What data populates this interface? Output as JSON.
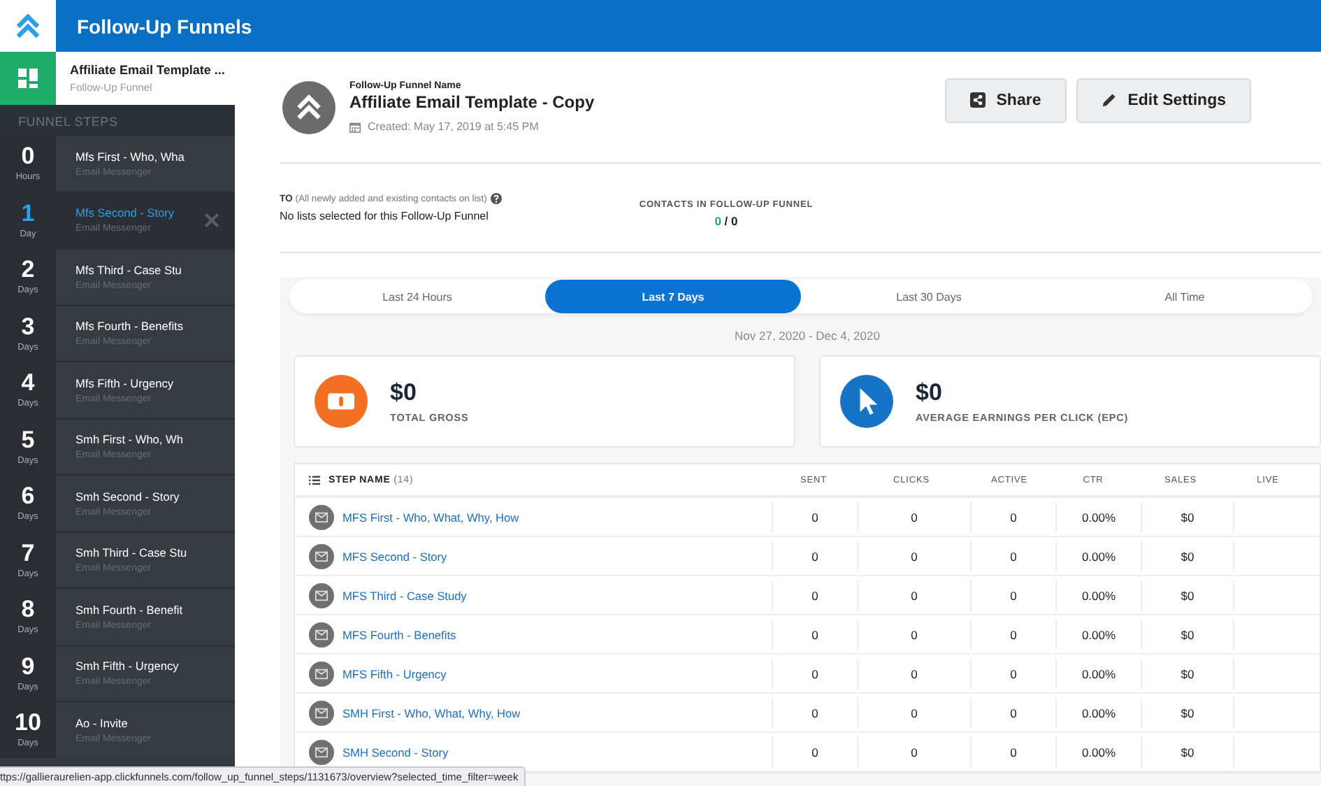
{
  "app": {
    "title": "Follow-Up Funnels"
  },
  "funnel": {
    "name": "Affiliate Email Template ...",
    "type": "Follow-Up Funnel"
  },
  "sidebar": {
    "heading": "FUNNEL STEPS",
    "steps": [
      {
        "number": "0",
        "unit": "Hours",
        "title": "Mfs First - Who, Wha",
        "subtitle": "Email Messenger",
        "selected": false
      },
      {
        "number": "1",
        "unit": "Day",
        "title": "Mfs Second - Story",
        "subtitle": "Email Messenger",
        "selected": true
      },
      {
        "number": "2",
        "unit": "Days",
        "title": "Mfs Third - Case Stu",
        "subtitle": "Email Messenger",
        "selected": false
      },
      {
        "number": "3",
        "unit": "Days",
        "title": "Mfs Fourth - Benefits",
        "subtitle": "Email Messenger",
        "selected": false
      },
      {
        "number": "4",
        "unit": "Days",
        "title": "Mfs Fifth - Urgency",
        "subtitle": "Email Messenger",
        "selected": false
      },
      {
        "number": "5",
        "unit": "Days",
        "title": "Smh First - Who, Wh",
        "subtitle": "Email Messenger",
        "selected": false
      },
      {
        "number": "6",
        "unit": "Days",
        "title": "Smh Second - Story",
        "subtitle": "Email Messenger",
        "selected": false
      },
      {
        "number": "7",
        "unit": "Days",
        "title": "Smh Third - Case Stu",
        "subtitle": "Email Messenger",
        "selected": false
      },
      {
        "number": "8",
        "unit": "Days",
        "title": "Smh Fourth - Benefit",
        "subtitle": "Email Messenger",
        "selected": false
      },
      {
        "number": "9",
        "unit": "Days",
        "title": "Smh Fifth - Urgency",
        "subtitle": "Email Messenger",
        "selected": false
      },
      {
        "number": "10",
        "unit": "Days",
        "title": "Ao - Invite",
        "subtitle": "Email Messenger",
        "selected": false
      }
    ]
  },
  "header": {
    "label": "Follow-Up Funnel Name",
    "title": "Affiliate Email Template - Copy",
    "created": "Created: May 17, 2019 at 5:45 PM",
    "buttons": [
      {
        "kind": "share",
        "label": "Share"
      },
      {
        "kind": "edit",
        "label": "Edit Settings"
      }
    ]
  },
  "recipients": {
    "label": "**TO** (All newly added and existing contacts on list)",
    "value": "No lists selected for this Follow-Up Funnel"
  },
  "contacts": {
    "label": "CONTACTS IN FOLLOW-UP FUNNEL",
    "count": "0",
    "separator": "/",
    "total": "0"
  },
  "tabs": [
    {
      "label": "Last 24 Hours",
      "selected": false
    },
    {
      "label": "Last 7 Days",
      "selected": true
    },
    {
      "label": "Last 30 Days",
      "selected": false
    },
    {
      "label": "All Time",
      "selected": false
    }
  ],
  "date_range": "Nov 27, 2020 - Dec 4, 2020",
  "stats": [
    {
      "kind": "gross",
      "value": "$0",
      "label": "TOTAL GROSS"
    },
    {
      "kind": "epc",
      "value": "$0",
      "label": "AVERAGE EARNINGS PER CLICK (EPC)"
    }
  ],
  "table": {
    "columns": [
      "**STEP NAME** (14)",
      "SENT",
      "CLICKS",
      "ACTIVE",
      "CTR",
      "SALES",
      "LIVE"
    ],
    "rows": [
      {
        "cells": [
          "MFS First - Who, What, Why, How",
          "0",
          "0",
          "0",
          "0.00%",
          "$0"
        ]
      },
      {
        "cells": [
          "MFS Second - Story",
          "0",
          "0",
          "0",
          "0.00%",
          "$0"
        ]
      },
      {
        "cells": [
          "MFS Third - Case Study",
          "0",
          "0",
          "0",
          "0.00%",
          "$0"
        ]
      },
      {
        "cells": [
          "MFS Fourth - Benefits",
          "0",
          "0",
          "0",
          "0.00%",
          "$0"
        ]
      },
      {
        "cells": [
          "MFS Fifth - Urgency",
          "0",
          "0",
          "0",
          "0.00%",
          "$0"
        ]
      },
      {
        "cells": [
          "SMH First - Who, What, Why, How",
          "0",
          "0",
          "0",
          "0.00%",
          "$0"
        ]
      },
      {
        "cells": [
          "SMH Second - Story",
          "0",
          "0",
          "0",
          "0.00%",
          "$0"
        ]
      }
    ]
  },
  "status_bar": "ttps://gallieraurelien-app.clickfunnels.com/follow_up_funnel_steps/1131673/overview?selected_time_filter=week"
}
